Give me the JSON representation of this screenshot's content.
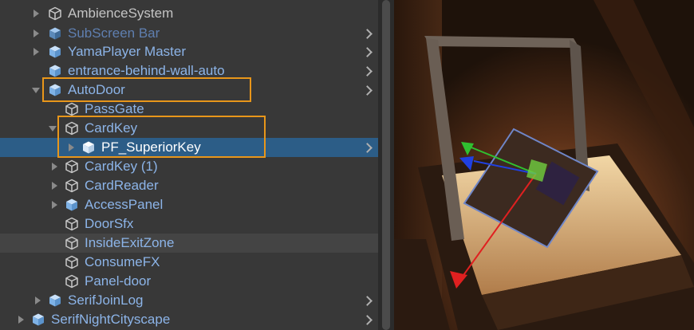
{
  "hierarchy": {
    "rows": [
      {
        "label": "AmbienceSystem"
      },
      {
        "label": "SubScreen Bar"
      },
      {
        "label": "YamaPlayer Master"
      },
      {
        "label": "entrance-behind-wall-auto"
      },
      {
        "label": "AutoDoor"
      },
      {
        "label": "PassGate"
      },
      {
        "label": "CardKey"
      },
      {
        "label": "PF_SuperiorKey"
      },
      {
        "label": "CardKey (1)"
      },
      {
        "label": "CardReader"
      },
      {
        "label": "AccessPanel"
      },
      {
        "label": "DoorSfx"
      },
      {
        "label": "InsideExitZone"
      },
      {
        "label": "ConsumeFX"
      },
      {
        "label": "Panel-door"
      },
      {
        "label": "SerifJoinLog"
      },
      {
        "label": "SerifNightCityscape"
      }
    ]
  },
  "colors": {
    "panel_bg": "#383838",
    "selection": "#2c5d87",
    "prefab_text": "#8cb4e8",
    "highlight_box": "#e8961a",
    "gizmo_x": "#e02020",
    "gizmo_y": "#30c030",
    "gizmo_z": "#2040e0"
  },
  "icons": {
    "gameobject": "cube-outline-icon",
    "prefab": "prefab-cube-icon",
    "foldout": "triangle-icon",
    "open_prefab": "chevron-right-icon"
  }
}
